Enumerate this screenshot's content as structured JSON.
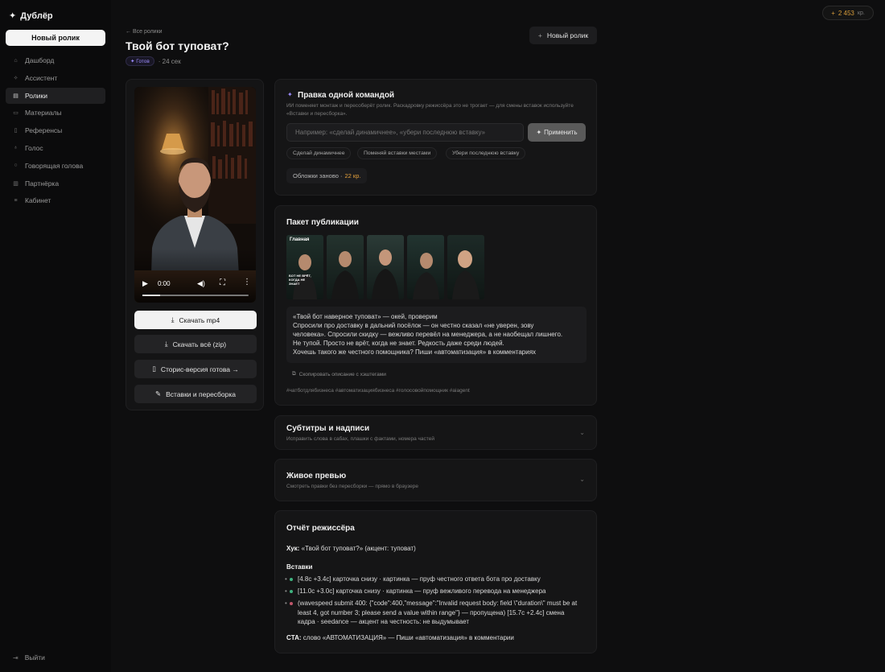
{
  "brand": {
    "name": "Дублёр"
  },
  "sidebar": {
    "new_button": "Новый ролик",
    "items": [
      {
        "label": "Дашборд",
        "icon": "home-icon"
      },
      {
        "label": "Ассистент",
        "icon": "sparkle-icon"
      },
      {
        "label": "Ролики",
        "icon": "film-icon"
      },
      {
        "label": "Материалы",
        "icon": "folder-icon"
      },
      {
        "label": "Референсы",
        "icon": "bookmark-icon"
      },
      {
        "label": "Голос",
        "icon": "mic-icon"
      },
      {
        "label": "Говорящая голова",
        "icon": "user-icon"
      },
      {
        "label": "Партнёрка",
        "icon": "handshake-icon"
      },
      {
        "label": "Кабинет",
        "icon": "settings-icon"
      }
    ],
    "active_index": 2,
    "logout": "Выйти"
  },
  "header": {
    "breadcrumb": "← Все ролики",
    "title": "Твой бот туповат?",
    "badge": "✦ Готов",
    "duration": "· 24 сек",
    "new_button": "Новый ролик"
  },
  "credits": {
    "value": "2 453",
    "unit": "кр."
  },
  "video": {
    "time": "0:00",
    "progress": 0.0,
    "buttons": [
      "Скачать mp4",
      "Скачать всё (zip)",
      "Сторис-версия готова →",
      "Вставки и пересборка"
    ]
  },
  "edit": {
    "title": "Правка одной командой",
    "subtitle": "ИИ поменяет монтаж и пересоберёт ролик. Раскадровку режиссёра это не трогает — для смены вставок используйте «Вставки и пересборка».",
    "placeholder": "Например: «сделай динамичнее», «убери последнюю вставку»",
    "apply": "Применить",
    "chips": [
      "Сделай динамичнее",
      "Поменяй вставки местами",
      "Убери последнюю вставку"
    ],
    "covers_label": "Обложки заново ·",
    "covers_price": "22 кр."
  },
  "publish": {
    "title": "Пакет публикации",
    "thumb_main_label": "Главная",
    "thumb_caption": "БОТ НЕ ВРЁТ, КОГДА НЕ ЗНАЕТ",
    "description": [
      "«Твой бот наверное туповат» — окей, проверим",
      "Спросили про доставку в дальний посёлок — он честно сказал «не уверен, зову",
      "человека». Спросили скидку — вежливо перевёл на менеджера, а не наобещал лишнего.",
      "Не тупой. Просто не врёт, когда не знает. Редкость даже среди людей.",
      "Хочешь такого же честного помощника? Пиши «автоматизация» в комментариях"
    ],
    "copy": "Скопировать описание с хэштегами",
    "hashtags": "#чатботдлябизнеса #автоматизациябизнеса #голосовойпомощник #aiagent"
  },
  "subtitles": {
    "title": "Субтитры и надписи",
    "subtitle": "Исправить слова в сабах, плашки с фактами, номера частей"
  },
  "preview": {
    "title": "Живое превью",
    "subtitle": "Смотреть правки без пересборки — прямо в браузере"
  },
  "report": {
    "title": "Отчёт режиссёра",
    "hook_label": "Хук:",
    "hook_text": "«Твой бот туповат?» (акцент: туповат)",
    "inserts_label": "Вставки",
    "inserts": [
      {
        "status": "ok",
        "text": "[4.8с +3.4с] карточка снизу · картинка — пруф честного ответа бота про доставку"
      },
      {
        "status": "ok",
        "text": "[11.0с +3.0с] карточка снизу · картинка — пруф вежливого перевода на менеджера"
      },
      {
        "status": "error",
        "text": "(wavespeed submit 400: {\"code\":400,\"message\":\"Invalid request body: field \\\"duration\\\" must be at least 4, got number 3; please send a value within range\"} — пропущена) [15.7с +2.4с] смена кадра · seedance — акцент на честность: не выдумывает"
      }
    ],
    "cta_label": "CTA:",
    "cta_text": "слово «АВТОМАТИЗАЦИЯ» — Пиши «автоматизация» в комментарии"
  },
  "colors": {
    "ok": "#3fb27f",
    "error": "#c0566a",
    "accent": "#9d8cff",
    "price": "#e6a23c"
  }
}
